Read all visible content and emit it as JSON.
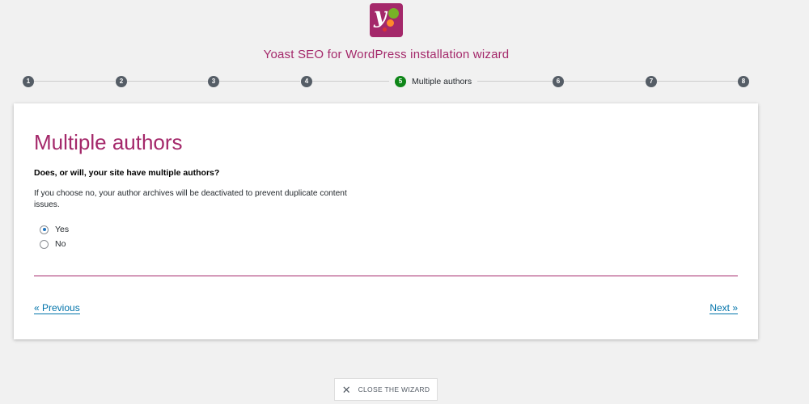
{
  "header": {
    "title": "Yoast SEO for WordPress installation wizard",
    "logo_letter": "y"
  },
  "stepper": {
    "steps": [
      "1",
      "2",
      "3",
      "4",
      "5",
      "6",
      "7",
      "8"
    ],
    "active_step": "5",
    "active_label": "Multiple authors"
  },
  "main": {
    "heading": "Multiple authors",
    "question": "Does, or will, your site have multiple authors?",
    "description": "If you choose no, your author archives will be deactivated to prevent duplicate content issues.",
    "options": [
      {
        "label": "Yes",
        "selected": true
      },
      {
        "label": "No",
        "selected": false
      }
    ]
  },
  "nav": {
    "previous": "« Previous",
    "next": "Next »"
  },
  "footer": {
    "close_label": "CLOSE THE WIZARD",
    "close_icon": "✕"
  },
  "colors": {
    "brand": "#a4286a",
    "active_step": "#0e8618",
    "step": "#555d66",
    "link": "#0073aa"
  }
}
